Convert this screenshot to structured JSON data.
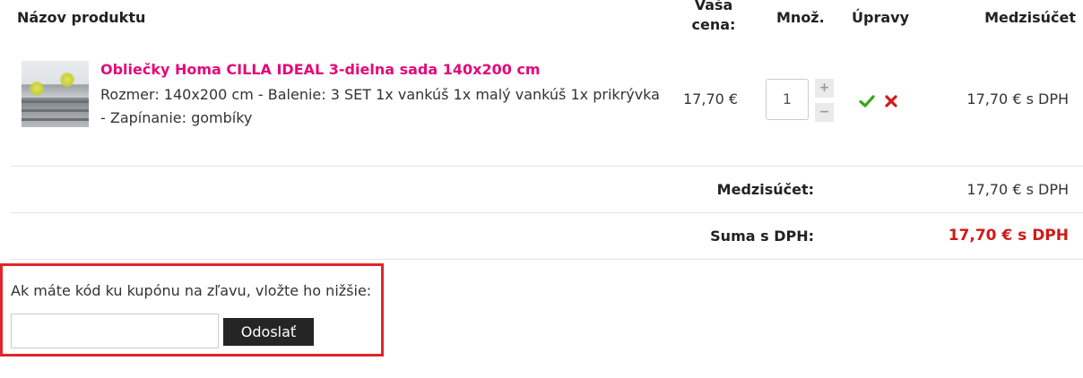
{
  "cart": {
    "headers": {
      "product": "Názov produktu",
      "price_line1": "Vaša",
      "price_line2": "cena:",
      "quantity": "Množ.",
      "edit": "Úpravy",
      "subtotal": "Medzisúčet"
    },
    "item": {
      "name": "Obliečky Homa CILLA IDEAL 3-dielna sada 140x200 cm",
      "description": "Rozmer: 140x200 cm - Balenie: 3 SET 1x vankúš 1x malý vankúš 1x prikrývka - Zapínanie: gombíky",
      "price": "17,70 €",
      "quantity": "1",
      "plus": "+",
      "minus": "−",
      "line_total": "17,70 € s DPH"
    },
    "summary": {
      "subtotal_label": "Medzisúčet:",
      "subtotal_value": "17,70 € s DPH",
      "total_label": "Suma s DPH:",
      "total_value": "17,70 € s DPH"
    }
  },
  "coupon": {
    "label": "Ak máte kód ku kupónu na zľavu, vložte ho nižšie:",
    "input_value": "",
    "button": "Odoslať"
  },
  "colors": {
    "product_link": "#e3097a",
    "total": "#d11919",
    "highlight_border": "#e0262a",
    "confirm_icon": "#3aa61b",
    "delete_icon": "#d11919"
  },
  "icons": {
    "confirm": "checkmark-icon",
    "delete": "close-icon"
  }
}
